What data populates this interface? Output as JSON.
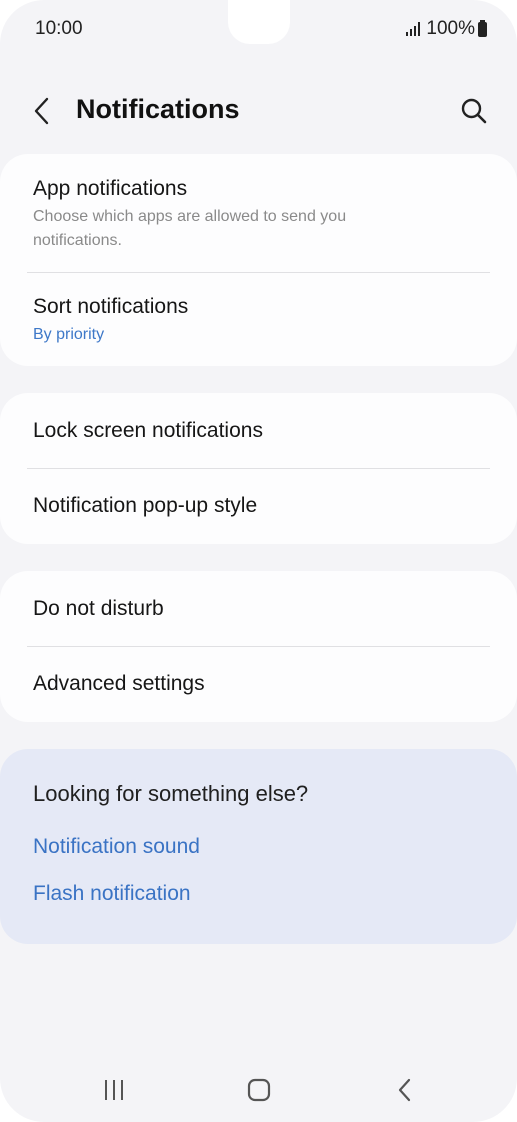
{
  "status_bar": {
    "time": "10:00",
    "battery": "100%"
  },
  "header": {
    "title": "Notifications",
    "back_icon": "back-arrow-icon",
    "search_icon": "search-icon"
  },
  "sections": [
    {
      "items": [
        {
          "title": "App notifications",
          "subtitle": "Choose which apps are allowed to send you notifications."
        },
        {
          "title": "Sort notifications",
          "value": "By priority"
        }
      ]
    },
    {
      "items": [
        {
          "title": "Lock screen notifications"
        },
        {
          "title": "Notification pop-up style"
        }
      ]
    },
    {
      "items": [
        {
          "title": "Do not disturb"
        },
        {
          "title": "Advanced settings"
        }
      ]
    }
  ],
  "suggestions": {
    "title": "Looking for something else?",
    "links": [
      "Notification sound",
      "Flash notification"
    ]
  },
  "colors": {
    "background": "#f4f4f7",
    "card": "#fdfdfe",
    "suggestion_card": "#e5e9f6",
    "accent": "#3e78c8"
  },
  "nav_bar": {
    "recents_icon": "recents-icon",
    "home_icon": "home-icon",
    "back_icon": "nav-back-icon"
  }
}
